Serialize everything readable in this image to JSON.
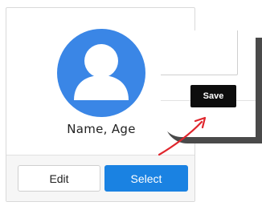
{
  "card": {
    "avatar_icon": "user-avatar-icon",
    "caption": "Name, Age",
    "edit_label": "Edit",
    "select_label": "Select"
  },
  "modal": {
    "save_label": "Save"
  },
  "colors": {
    "avatar_blue": "#3a86e6",
    "select_blue": "#1a82e2",
    "save_black": "#0d0d0d",
    "arrow_red": "#e0262d",
    "zoom_shadow": "#4a4a4a"
  }
}
